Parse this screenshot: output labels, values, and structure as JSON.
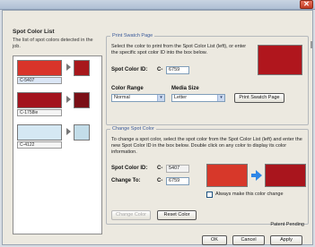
{
  "window": {
    "close_glyph": "✕"
  },
  "left": {
    "title": "Spot Color List",
    "description": "The list of spot colors detected in the job.",
    "items": [
      {
        "label": "C-5407",
        "main_color": "#d9342a",
        "secondary_color": "#a8181c"
      },
      {
        "label": "C-1758ie",
        "main_color": "#a3131d",
        "secondary_color": "#7a0f16"
      },
      {
        "label": "C-4122",
        "main_color": "#d5e8f3",
        "secondary_color": "#c3dde9"
      }
    ]
  },
  "print_swatch": {
    "title": "Print Swatch Page",
    "instructions": "Select the color to print from the Spot Color List (left), or enter the specific spot color ID into the box below.",
    "spot_id_label": "Spot Color ID:",
    "prefix": "C-",
    "spot_id_value": "6759",
    "swatch_color": "#b0161d",
    "color_range_label": "Color Range",
    "color_range_value": "Normal",
    "media_size_label": "Media Size",
    "media_size_value": "Letter",
    "print_button": "Print Swatch Page"
  },
  "change_spot": {
    "title": "Change Spot Color",
    "instructions": "To change a spot color, select the spot color from the Spot Color List (left) and enter the new Spot Color ID in the box below. Double click on any color to display its color information.",
    "spot_id_label": "Spot Color ID:",
    "prefix": "C-",
    "spot_id_value": "5407",
    "change_to_label": "Change To:",
    "change_to_value": "6759",
    "from_color": "#d7382a",
    "to_color": "#a9151d",
    "checkbox_label": "Always make this color change",
    "change_button": "Change Color",
    "reset_button": "Reset Color"
  },
  "footer": {
    "patent": "Patent Pending",
    "ok": "OK",
    "cancel": "Cancel",
    "apply": "Apply"
  }
}
